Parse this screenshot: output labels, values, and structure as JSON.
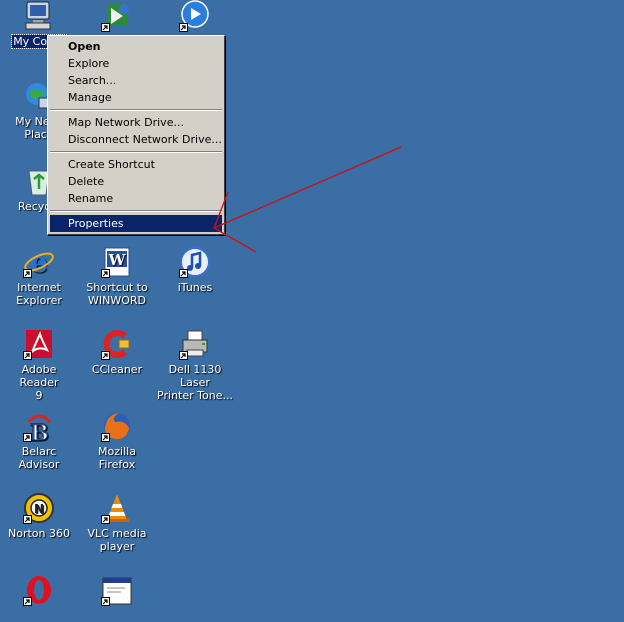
{
  "desktop": {
    "background_color": "#3a6ea5",
    "icons": [
      {
        "id": "my-computer",
        "label": "My Comp",
        "selected": true
      },
      {
        "id": "media",
        "label": ""
      },
      {
        "id": "media-player",
        "label": ""
      },
      {
        "id": "network-places",
        "label": "My Netw\nPlace"
      },
      {
        "id": "recycle-bin",
        "label": "Recycle"
      },
      {
        "id": "internet-explorer",
        "label": "Internet\nExplorer"
      },
      {
        "id": "winword",
        "label": "Shortcut to\nWINWORD"
      },
      {
        "id": "itunes",
        "label": "iTunes"
      },
      {
        "id": "adobe-reader",
        "label": "Adobe Reader\n9"
      },
      {
        "id": "ccleaner",
        "label": "CCleaner"
      },
      {
        "id": "dell-printer",
        "label": "Dell 1130 Laser\nPrinter Tone..."
      },
      {
        "id": "belarc",
        "label": "Belarc Advisor"
      },
      {
        "id": "firefox",
        "label": "Mozilla Firefox"
      },
      {
        "id": "norton",
        "label": "Norton 360"
      },
      {
        "id": "vlc",
        "label": "VLC media\nplayer"
      },
      {
        "id": "opera",
        "label": ""
      },
      {
        "id": "app-window",
        "label": ""
      }
    ]
  },
  "context_menu": {
    "items": [
      {
        "label": "Open",
        "bold": true
      },
      {
        "label": "Explore"
      },
      {
        "label": "Search..."
      },
      {
        "label": "Manage"
      },
      {
        "label": "Map Network Drive..."
      },
      {
        "label": "Disconnect Network Drive..."
      },
      {
        "label": "Create Shortcut"
      },
      {
        "label": "Delete"
      },
      {
        "label": "Rename"
      },
      {
        "label": "Properties",
        "highlighted": true
      }
    ],
    "highlight_color": "#0a246a"
  },
  "annotation": {
    "color": "#cc1111"
  }
}
